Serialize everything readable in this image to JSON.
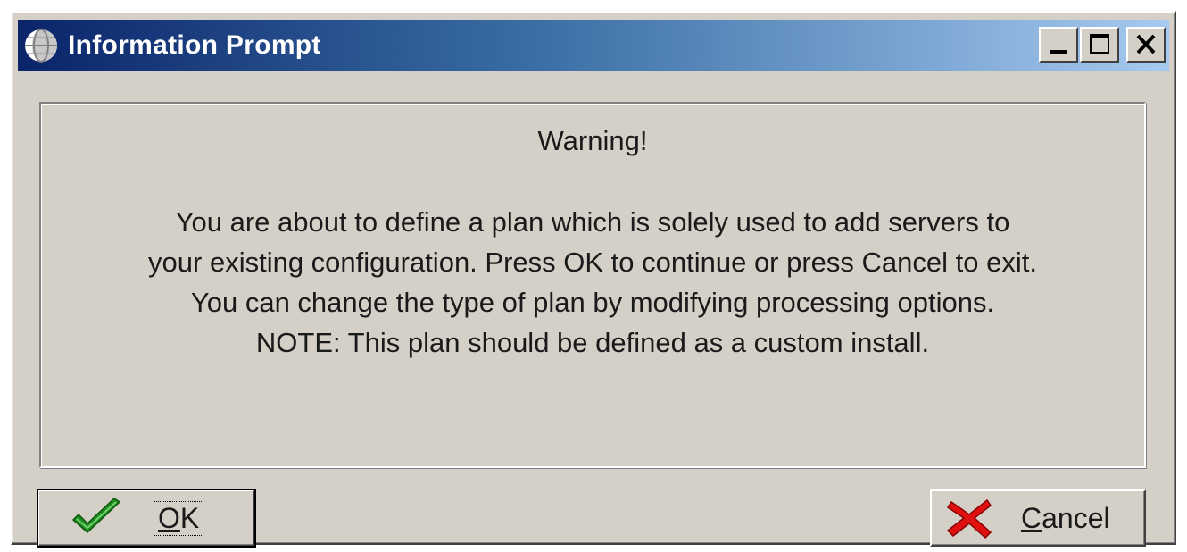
{
  "window": {
    "title": "Information Prompt"
  },
  "dialog": {
    "heading": "Warning!",
    "lines": [
      "You are about to define a plan which is solely used to add servers to",
      "your existing configuration. Press OK to continue or press Cancel to exit.",
      "You can change the type of plan by modifying processing options.",
      "NOTE: This plan should be defined as a custom install."
    ]
  },
  "buttons": {
    "ok": {
      "mnemonic": "O",
      "rest": "K",
      "icon": "checkmark-icon"
    },
    "cancel": {
      "mnemonic": "C",
      "rest": "ancel",
      "icon": "x-icon"
    }
  },
  "colors": {
    "titlebar_start": "#0a246a",
    "titlebar_end": "#a6caf0",
    "face": "#d4d0c8",
    "check_green": "#1e8a1e",
    "cancel_red": "#e01010"
  }
}
